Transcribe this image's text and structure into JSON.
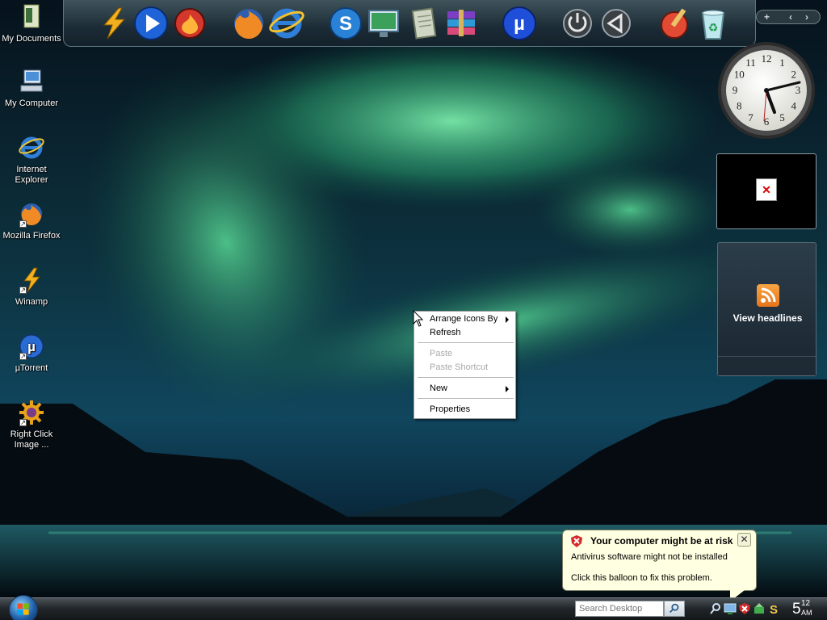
{
  "desktop_icons": [
    {
      "label": "My Documents",
      "icon": "my-documents-icon"
    },
    {
      "label": "My Computer",
      "icon": "my-computer-icon"
    },
    {
      "label": "Internet Explorer",
      "icon": "internet-explorer-icon"
    },
    {
      "label": "Mozilla Firefox",
      "icon": "firefox-icon"
    },
    {
      "label": "Winamp",
      "icon": "winamp-icon"
    },
    {
      "label": "µTorrent",
      "icon": "utorrent-icon"
    },
    {
      "label": "Right Click Image ...",
      "icon": "right-click-image-icon"
    }
  ],
  "dock": {
    "items": [
      "winamp-icon",
      "media-player-icon",
      "burn-disc-icon",
      "firefox-icon",
      "internet-explorer-icon",
      "skype-icon",
      "display-icon",
      "notepad-icon",
      "winrar-icon",
      "utorrent-icon",
      "power-icon",
      "volume-icon",
      "paint-icon",
      "recycle-bin-icon"
    ]
  },
  "sidebar": {
    "add_label": "+",
    "prev_label": "‹",
    "next_label": "›"
  },
  "clock_gadget": {
    "numbers": [
      "12",
      "1",
      "2",
      "3",
      "4",
      "5",
      "6",
      "7",
      "8",
      "9",
      "10",
      "11"
    ],
    "time": "5:12"
  },
  "feed_gadget": {
    "label": "View headlines",
    "icon": "rss-icon"
  },
  "context_menu": {
    "items": [
      {
        "label": "Arrange Icons By",
        "enabled": true,
        "submenu": true
      },
      {
        "label": "Refresh",
        "enabled": true,
        "submenu": false
      },
      {
        "label": "Paste",
        "enabled": false,
        "submenu": false
      },
      {
        "label": "Paste Shortcut",
        "enabled": false,
        "submenu": false
      },
      {
        "label": "New",
        "enabled": true,
        "submenu": true
      },
      {
        "label": "Properties",
        "enabled": true,
        "submenu": false
      }
    ]
  },
  "balloon": {
    "title": "Your computer might be at risk",
    "line1": "Antivirus software might not be installed",
    "line2": "Click this balloon to fix this problem.",
    "close_label": "✕"
  },
  "taskbar": {
    "search_placeholder": "Search Desktop",
    "clock_hour": "5",
    "clock_minutes": "12",
    "clock_ampm": "AM"
  },
  "colors": {
    "balloon_bg": "#ffffe1",
    "aurora": "#3ec98a",
    "menu_disabled": "#a9a9a9"
  }
}
